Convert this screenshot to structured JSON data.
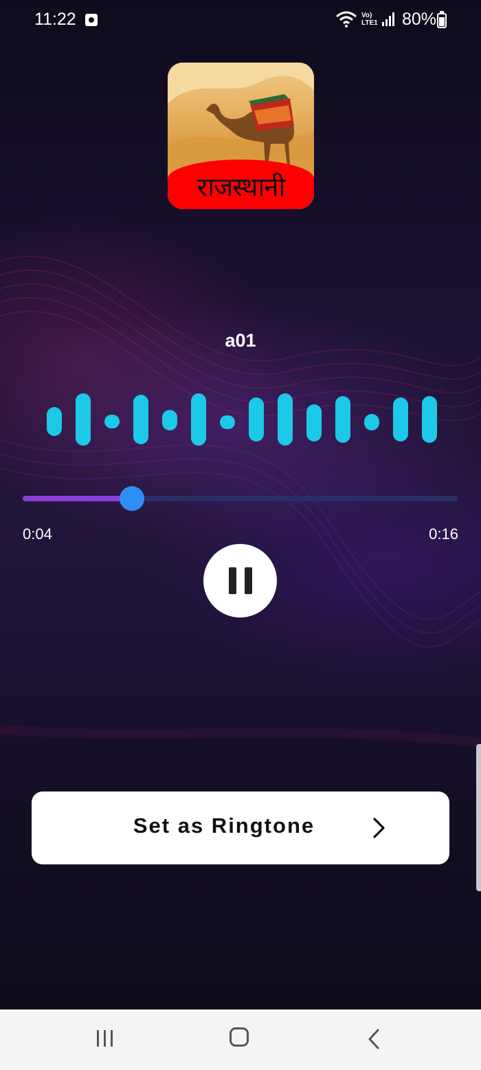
{
  "status_bar": {
    "time": "11:22",
    "network_label": "Vo)\nLTE1",
    "battery": "80%"
  },
  "art": {
    "caption": "राजस्थानी"
  },
  "player": {
    "track_title": "a01",
    "current_time": "0:04",
    "total_time": "0:16",
    "progress": 0.25,
    "state": "playing",
    "accent_color": "#2d8ef5",
    "wave_color": "#1ec8e8"
  },
  "actions": {
    "set_ringtone_label": "Set as Ringtone"
  },
  "navigation": {
    "recents": "recents-icon",
    "home": "home-icon",
    "back": "back-icon"
  }
}
